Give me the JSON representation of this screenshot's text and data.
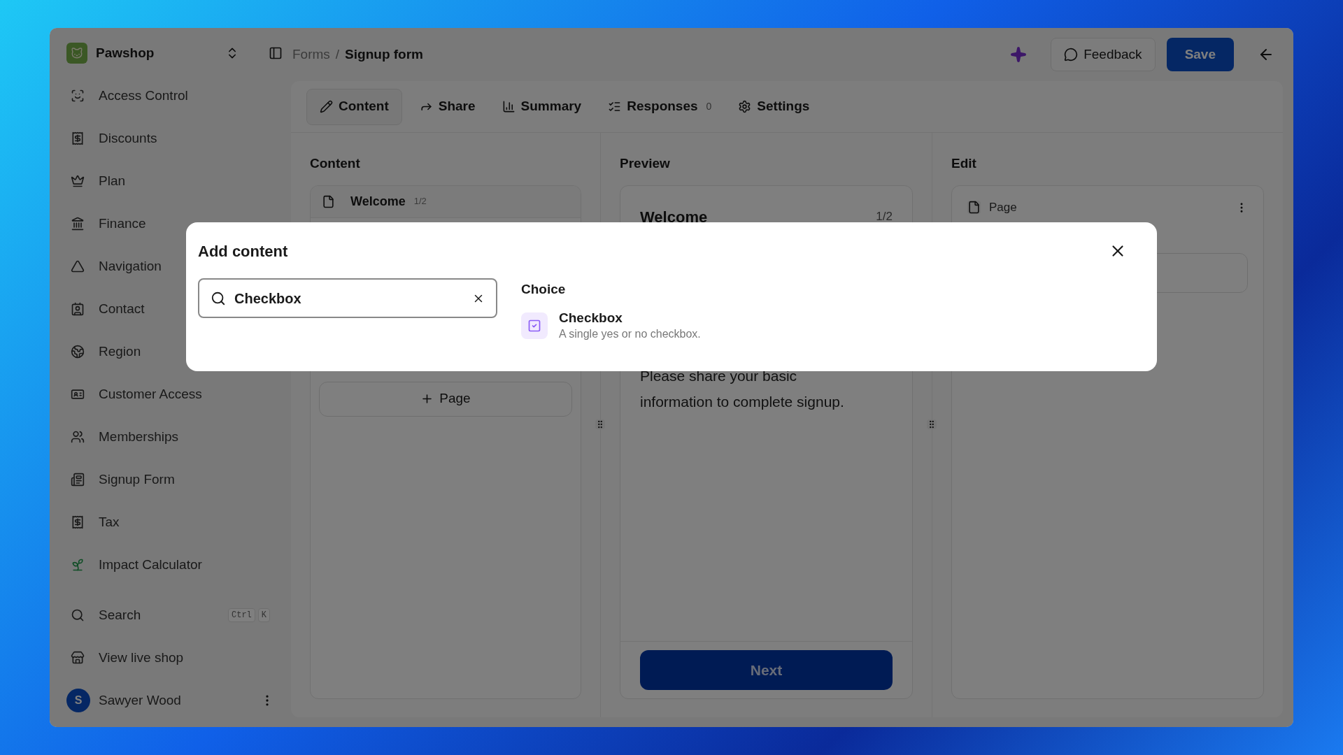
{
  "sidebar": {
    "shop": {
      "name": "Pawshop"
    },
    "items": [
      {
        "label": "Access Control"
      },
      {
        "label": "Discounts"
      },
      {
        "label": "Plan"
      },
      {
        "label": "Finance"
      },
      {
        "label": "Navigation"
      },
      {
        "label": "Contact"
      },
      {
        "label": "Region"
      },
      {
        "label": "Customer Access"
      },
      {
        "label": "Memberships"
      },
      {
        "label": "Signup Form"
      },
      {
        "label": "Tax"
      },
      {
        "label": "Impact Calculator"
      }
    ],
    "search": {
      "label": "Search",
      "keys": [
        "Ctrl",
        "K"
      ]
    },
    "live_shop": {
      "label": "View live shop"
    },
    "user": {
      "initial": "S",
      "name": "Sawyer Wood"
    }
  },
  "header": {
    "breadcrumb": [
      "Forms",
      "Signup form"
    ],
    "separator": "/",
    "feedback": "Feedback",
    "save": "Save"
  },
  "tabs": [
    {
      "label": "Content",
      "selected": true
    },
    {
      "label": "Share",
      "selected": false
    },
    {
      "label": "Summary",
      "selected": false
    },
    {
      "label": "Responses",
      "count": "0",
      "selected": false
    },
    {
      "label": "Settings",
      "selected": false
    }
  ],
  "content_column": {
    "title": "Content",
    "pages": [
      {
        "title": "Welcome",
        "number": "1/2"
      }
    ],
    "add_page": "Page"
  },
  "preview_column": {
    "title": "Preview",
    "page_title": "Welcome",
    "page_number": "1/2",
    "body": "Please share your basic information to complete signup.",
    "next": "Next"
  },
  "edit_column": {
    "title": "Edit",
    "item": "Page"
  },
  "dialog": {
    "title": "Add content",
    "search": {
      "value": "Checkbox"
    },
    "sections": [
      {
        "title": "Choice",
        "items": [
          {
            "title": "Checkbox",
            "description": "A single yes or no checkbox."
          }
        ]
      }
    ]
  }
}
